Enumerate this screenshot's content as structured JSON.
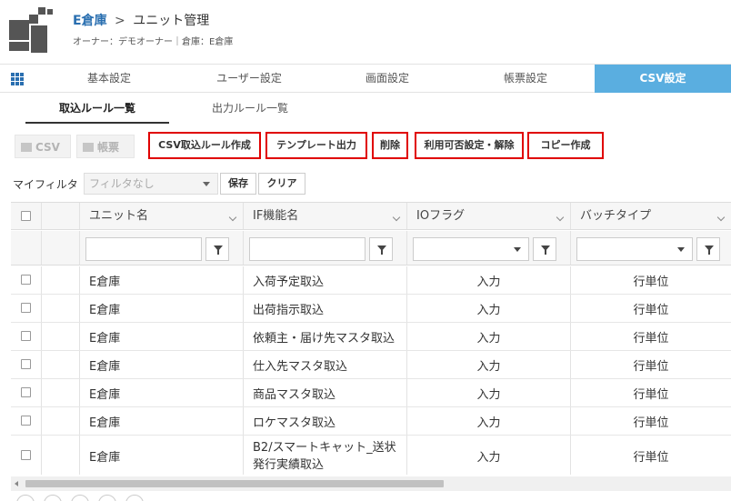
{
  "header": {
    "warehouse_link": "E倉庫",
    "separator": ">",
    "page_title": "ユニット管理",
    "subtitle": "オーナー：デモオーナー｜倉庫：E倉庫"
  },
  "main_nav": {
    "tabs": [
      {
        "label": "基本設定"
      },
      {
        "label": "ユーザー設定"
      },
      {
        "label": "画面設定"
      },
      {
        "label": "帳票設定"
      },
      {
        "label": "CSV設定",
        "active": true
      }
    ]
  },
  "sub_tabs": [
    {
      "label": "取込ルール一覧",
      "active": true
    },
    {
      "label": "出力ルール一覧"
    }
  ],
  "toolbar": {
    "csv_label": "CSV",
    "print_label": "帳票",
    "create_rule_label": "CSV取込ルール作成",
    "template_label": "テンプレート出力",
    "delete_label": "削除",
    "availability_label": "利用可否設定・解除",
    "copy_label": "コピー作成"
  },
  "filter": {
    "label": "マイフィルタ",
    "selected": "フィルタなし",
    "save_label": "保存",
    "clear_label": "クリア"
  },
  "table": {
    "columns": [
      "ユニット名",
      "IF機能名",
      "IOフラグ",
      "バッチタイプ"
    ],
    "rows": [
      {
        "unit": "E倉庫",
        "if_name": "入荷予定取込",
        "io": "入力",
        "batch": "行単位"
      },
      {
        "unit": "E倉庫",
        "if_name": "出荷指示取込",
        "io": "入力",
        "batch": "行単位"
      },
      {
        "unit": "E倉庫",
        "if_name": "依頼主・届け先マスタ取込",
        "io": "入力",
        "batch": "行単位"
      },
      {
        "unit": "E倉庫",
        "if_name": "仕入先マスタ取込",
        "io": "入力",
        "batch": "行単位"
      },
      {
        "unit": "E倉庫",
        "if_name": "商品マスタ取込",
        "io": "入力",
        "batch": "行単位"
      },
      {
        "unit": "E倉庫",
        "if_name": "ロケマスタ取込",
        "io": "入力",
        "batch": "行単位"
      },
      {
        "unit": "E倉庫",
        "if_name_line1": "B2/スマートキャット_送状",
        "if_name_line2": "発行実績取込",
        "io": "入力",
        "batch": "行単位"
      }
    ]
  },
  "colors": {
    "accent": "#2a6fb0",
    "active_tab": "#5aaee0",
    "highlight_border": "#e00000"
  }
}
